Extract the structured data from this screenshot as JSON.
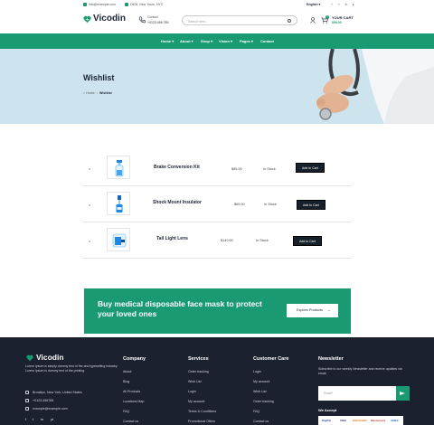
{
  "topbar": {
    "email": "info@example.com",
    "location": "D405, New Yourk, NYC",
    "language": "English"
  },
  "header": {
    "logo": "Vicodin",
    "phone_label": "Contact",
    "phone": "+0123 456 789",
    "search_placeholder": "Search here...",
    "cart_label": "YOUR CART",
    "cart_total": "$99.00",
    "cart_count": "0"
  },
  "nav": [
    {
      "label": "Home"
    },
    {
      "label": "About"
    },
    {
      "label": "Shop"
    },
    {
      "label": "Vision"
    },
    {
      "label": "Pages"
    },
    {
      "label": "Contact"
    }
  ],
  "banner": {
    "title": "Wishlist",
    "crumb_home": "Home",
    "crumb_current": "Wishlist"
  },
  "wishlist": [
    {
      "name": "Brake Conversion Kit",
      "price": "$85.00",
      "stock": "In Stock",
      "button": "Add to Cart"
    },
    {
      "name": "Shock Mount Insulator",
      "price": "$69.00",
      "stock": "In Stock",
      "button": "Add to Cart"
    },
    {
      "name": "Tail Light Lens",
      "price": "$149.00",
      "stock": "In Stock",
      "button": "Add to Cart"
    }
  ],
  "cta": {
    "title": "Buy medical disposable face mask to protect your loved ones",
    "button": "Explore Products"
  },
  "footer": {
    "logo": "Vicodin",
    "description": "Lorem Ipsum is simply dummy text of the and typesetting industry. Lorem Ipsum is dummy text of the printing.",
    "address": "Brooklyn, New York, United States",
    "phone": "+0123-456789",
    "email": "example@example.com",
    "socials": [
      "f",
      "t",
      "in",
      "yt"
    ],
    "columns": [
      {
        "title": "Company",
        "links": [
          "About",
          "Blog",
          "All Products",
          "Locations Map",
          "FAQ",
          "Contact us"
        ]
      },
      {
        "title": "Services",
        "links": [
          "Order tracking",
          "Wish List",
          "Login",
          "My account",
          "Terms & Conditions",
          "Promotional Offers"
        ]
      },
      {
        "title": "Customer Care",
        "links": [
          "Login",
          "My account",
          "Wish List",
          "Order tracking",
          "FAQ",
          "Contact us"
        ]
      }
    ],
    "newsletter_title": "Newsletter",
    "newsletter_text": "Subscribe to our weekly Newsletter and receive updates via email.",
    "newsletter_placeholder": "Email*",
    "accept_title": "We Accept",
    "payments": [
      "PayPal",
      "VISA",
      "DISCOVER",
      "Mastercard",
      "AMEX"
    ]
  },
  "colors": {
    "brand": "#1a9a73",
    "dark": "#1c2130",
    "banner": "#cde4ee"
  }
}
